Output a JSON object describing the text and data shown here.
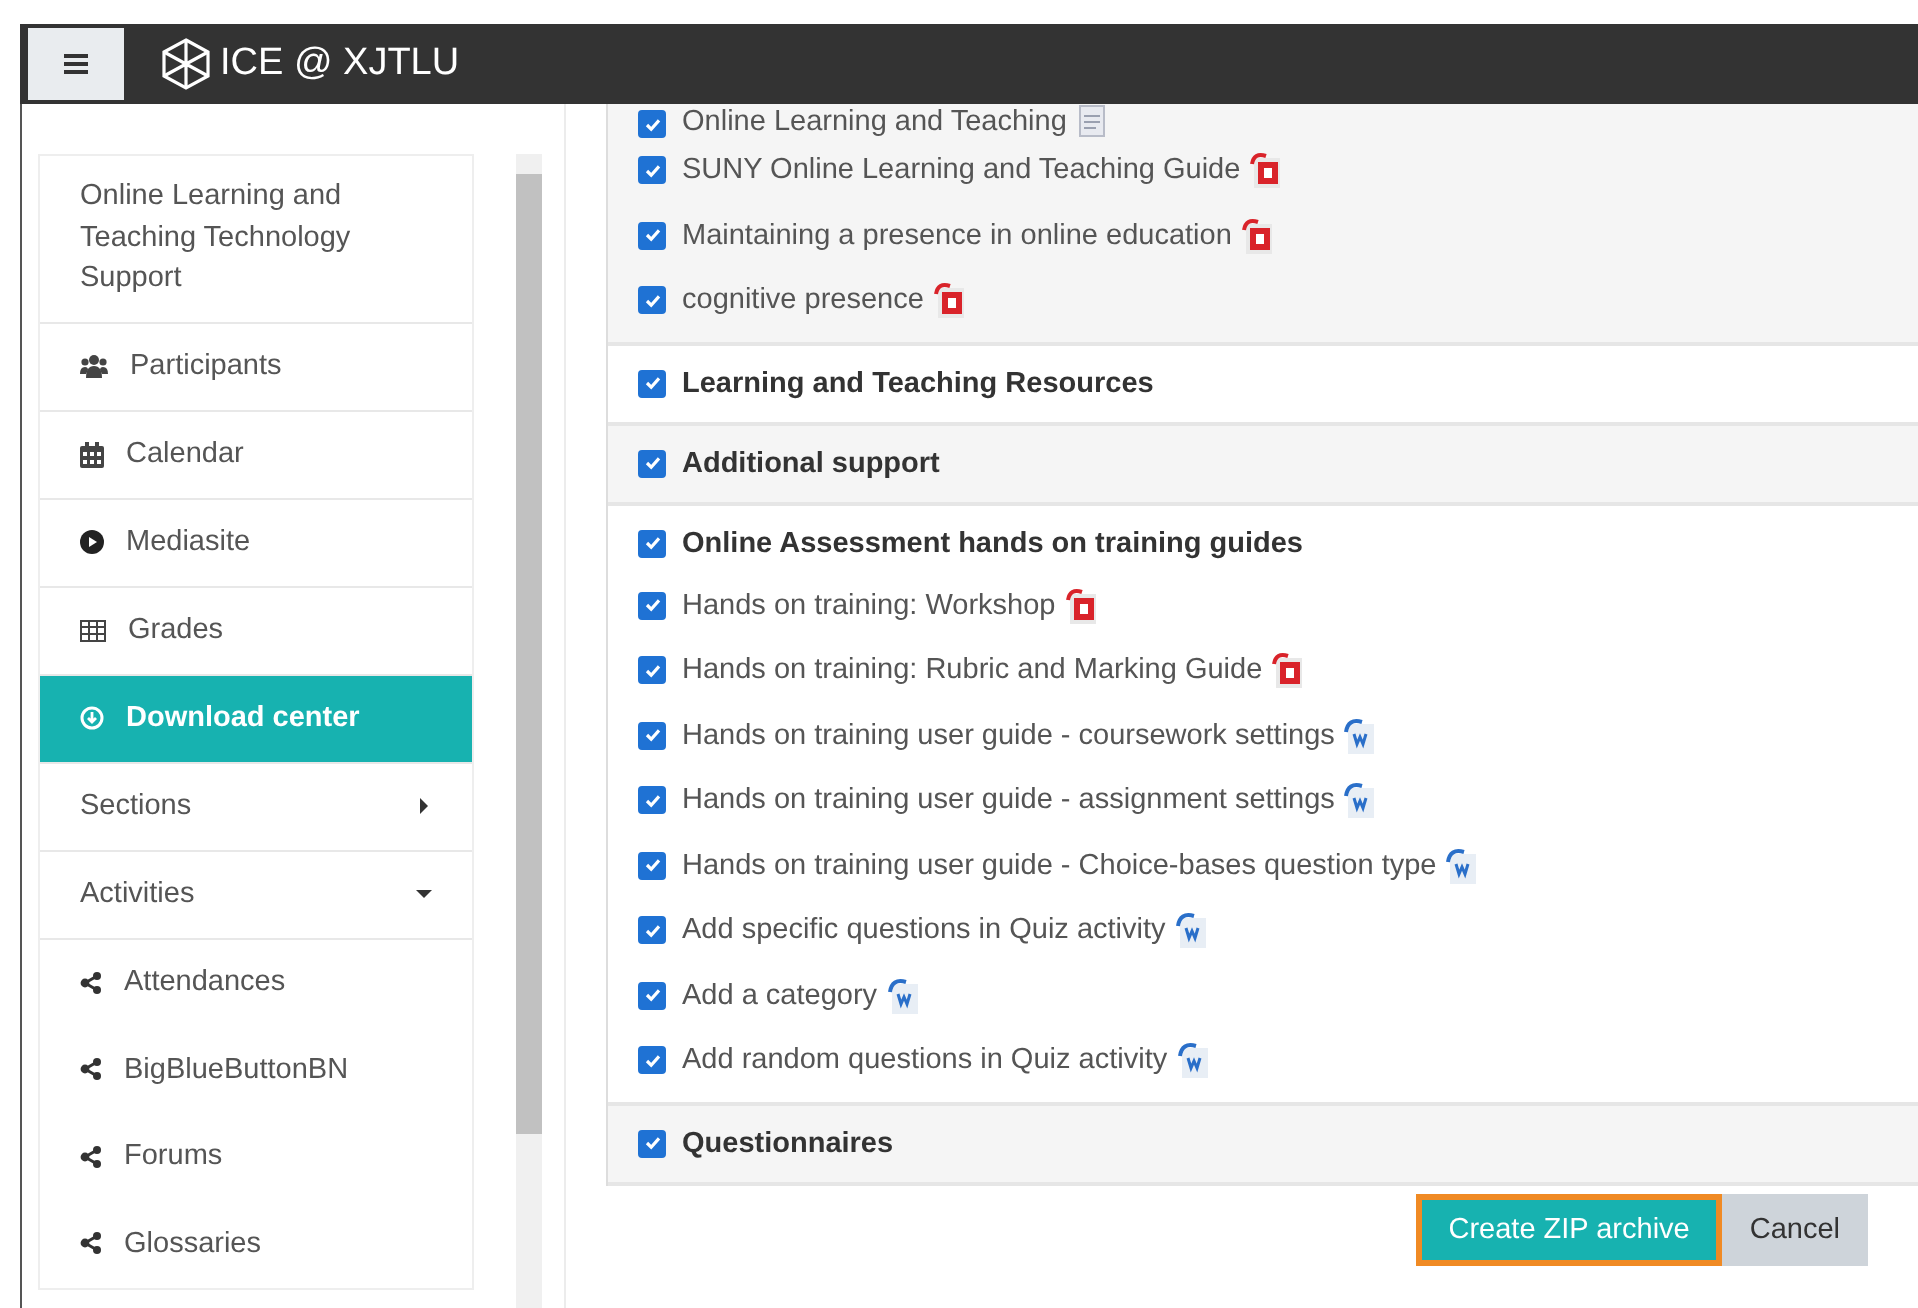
{
  "header": {
    "title": "ICE @ XJTLU"
  },
  "sidebar": {
    "course_title": "Online Learning and Teaching Technology Support",
    "items": [
      {
        "label": "Participants",
        "kind": "link",
        "selected": false
      },
      {
        "label": "Calendar",
        "kind": "link",
        "selected": false
      },
      {
        "label": "Mediasite",
        "kind": "link",
        "selected": false
      },
      {
        "label": "Grades",
        "kind": "link",
        "selected": false
      },
      {
        "label": "Download center",
        "kind": "link",
        "selected": true
      },
      {
        "label": "Sections",
        "kind": "group",
        "selected": false,
        "expanded": false
      },
      {
        "label": "Activities",
        "kind": "group",
        "selected": false,
        "expanded": true,
        "children": [
          {
            "label": "Attendances"
          },
          {
            "label": "BigBlueButtonBN"
          },
          {
            "label": "Forums"
          },
          {
            "label": "Glossaries"
          }
        ]
      }
    ]
  },
  "sections": [
    {
      "items": [
        {
          "label": "Online Learning and Teaching",
          "kind": "file",
          "checked": true
        },
        {
          "label": "SUNY Online Learning and Teaching Guide",
          "kind": "pdf",
          "checked": true
        },
        {
          "label": "Maintaining a presence in online education",
          "kind": "pdf",
          "checked": true
        },
        {
          "label": "cognitive presence",
          "kind": "pdf",
          "checked": true
        }
      ]
    },
    {
      "title": "Learning and Teaching Resources",
      "checked": true
    },
    {
      "title": "Additional support",
      "checked": true
    },
    {
      "title": "Online Assessment hands on training guides",
      "checked": true,
      "items": [
        {
          "label": "Hands on training: Workshop",
          "kind": "pdf",
          "checked": true
        },
        {
          "label": "Hands on training: Rubric and Marking Guide",
          "kind": "pdf",
          "checked": true
        },
        {
          "label": "Hands on training user guide - coursework settings",
          "kind": "word",
          "checked": true
        },
        {
          "label": "Hands on training user guide - assignment settings",
          "kind": "word",
          "checked": true
        },
        {
          "label": "Hands on training user guide - Choice-bases question type",
          "kind": "word",
          "checked": true
        },
        {
          "label": "Add specific questions in Quiz activity",
          "kind": "word",
          "checked": true
        },
        {
          "label": "Add a category",
          "kind": "word",
          "checked": true
        },
        {
          "label": "Add random questions in Quiz activity",
          "kind": "word",
          "checked": true
        }
      ]
    },
    {
      "title": "Questionnaires",
      "checked": true
    }
  ],
  "buttons": [
    {
      "label": "Create ZIP archive",
      "kind": "primary"
    },
    {
      "label": "Cancel",
      "kind": "secondary"
    }
  ]
}
